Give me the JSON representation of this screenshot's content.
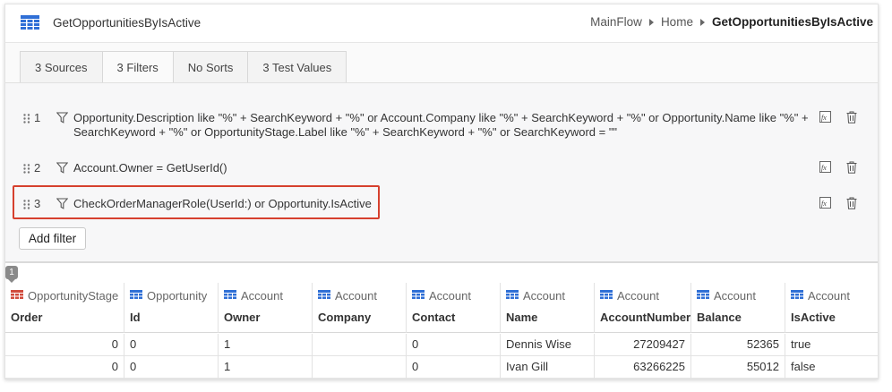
{
  "header": {
    "title": "GetOpportunitiesByIsActive",
    "breadcrumb": [
      "MainFlow",
      "Home",
      "GetOpportunitiesByIsActive"
    ]
  },
  "tabs": [
    "3 Sources",
    "3 Filters",
    "No Sorts",
    "3 Test Values"
  ],
  "active_tab": "3 Filters",
  "filters": [
    {
      "index": "1",
      "line1": "Opportunity.Description like \"%\" + SearchKeyword + \"%\" or Account.Company like \"%\" + SearchKeyword + \"%\" or Opportunity.Name like \"%\" +",
      "line2": "SearchKeyword + \"%\" or OpportunityStage.Label like \"%\" + SearchKeyword + \"%\" or SearchKeyword = \"\""
    },
    {
      "index": "2",
      "line1": "Account.Owner = GetUserId()",
      "line2": ""
    },
    {
      "index": "3",
      "line1": "CheckOrderManagerRole(UserId:) or Opportunity.IsActive",
      "line2": ""
    }
  ],
  "add_filter_label": "Add filter",
  "result_count": "1",
  "table": {
    "columns": [
      {
        "entity": "OpportunityStage",
        "attr": "Order"
      },
      {
        "entity": "Opportunity",
        "attr": "Id"
      },
      {
        "entity": "Account",
        "attr": "Owner"
      },
      {
        "entity": "Account",
        "attr": "Company"
      },
      {
        "entity": "Account",
        "attr": "Contact"
      },
      {
        "entity": "Account",
        "attr": "Name"
      },
      {
        "entity": "Account",
        "attr": "AccountNumber"
      },
      {
        "entity": "Account",
        "attr": "Balance"
      },
      {
        "entity": "Account",
        "attr": "IsActive"
      }
    ],
    "rows": [
      [
        "0",
        "0",
        "1",
        "",
        "0",
        "Dennis Wise",
        "27209427",
        "52365",
        "true"
      ],
      [
        "0",
        "0",
        "1",
        "",
        "0",
        "Ivan Gill",
        "63266225",
        "55012",
        "false"
      ]
    ]
  },
  "colors": {
    "accent_blue": "#2f6fd6",
    "highlight_red": "#d6402e",
    "entity_icon_red": "#d14b3c"
  }
}
